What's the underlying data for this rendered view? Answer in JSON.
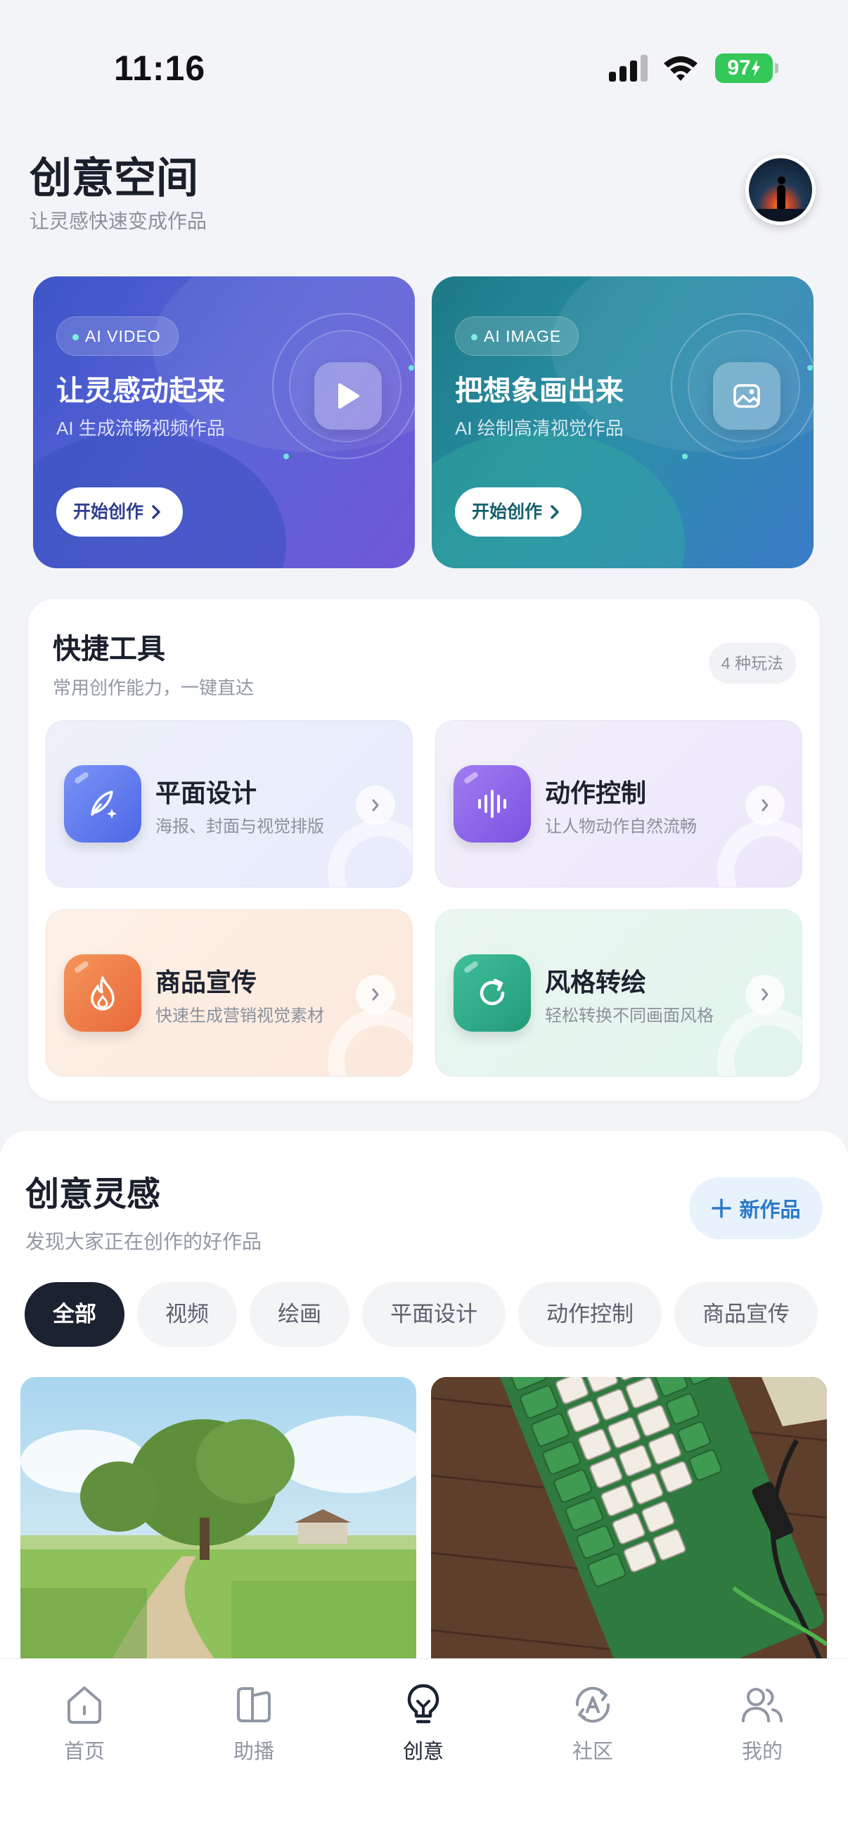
{
  "status": {
    "time": "11:16",
    "battery": "97"
  },
  "header": {
    "title": "创意空间",
    "subtitle": "让灵感快速变成作品"
  },
  "hero_cards": [
    {
      "tag": "AI VIDEO",
      "title": "让灵感动起来",
      "subtitle": "AI 生成流畅视频作品",
      "button": "开始创作"
    },
    {
      "tag": "AI IMAGE",
      "title": "把想象画出来",
      "subtitle": "AI 绘制高清视觉作品",
      "button": "开始创作"
    }
  ],
  "tools": {
    "title": "快捷工具",
    "subtitle": "常用创作能力，一键直达",
    "badge": "4 种玩法",
    "items": [
      {
        "name": "平面设计",
        "desc": "海报、封面与视觉排版",
        "icon": "pen-icon"
      },
      {
        "name": "动作控制",
        "desc": "让人物动作自然流畅",
        "icon": "waveform-icon"
      },
      {
        "name": "商品宣传",
        "desc": "快速生成营销视觉素材",
        "icon": "flame-icon"
      },
      {
        "name": "风格转绘",
        "desc": "轻松转换不同画面风格",
        "icon": "refresh-icon"
      }
    ]
  },
  "inspiration": {
    "title": "创意灵感",
    "subtitle": "发现大家正在创作的好作品",
    "new_button": "新作品",
    "chips": [
      "全部",
      "视频",
      "绘画",
      "平面设计",
      "动作控制",
      "商品宣传"
    ],
    "active_chip": "全部"
  },
  "tabbar": [
    {
      "label": "首页",
      "icon": "home-icon"
    },
    {
      "label": "助播",
      "icon": "assistant-icon"
    },
    {
      "label": "创意",
      "icon": "lightbulb-icon",
      "active": true
    },
    {
      "label": "社区",
      "icon": "community-icon"
    },
    {
      "label": "我的",
      "icon": "profile-icon"
    }
  ],
  "colors": {
    "accent": "#2c79c8",
    "video_card": "#5a64d8",
    "image_card": "#2a8fa6",
    "battery": "#34c759"
  }
}
